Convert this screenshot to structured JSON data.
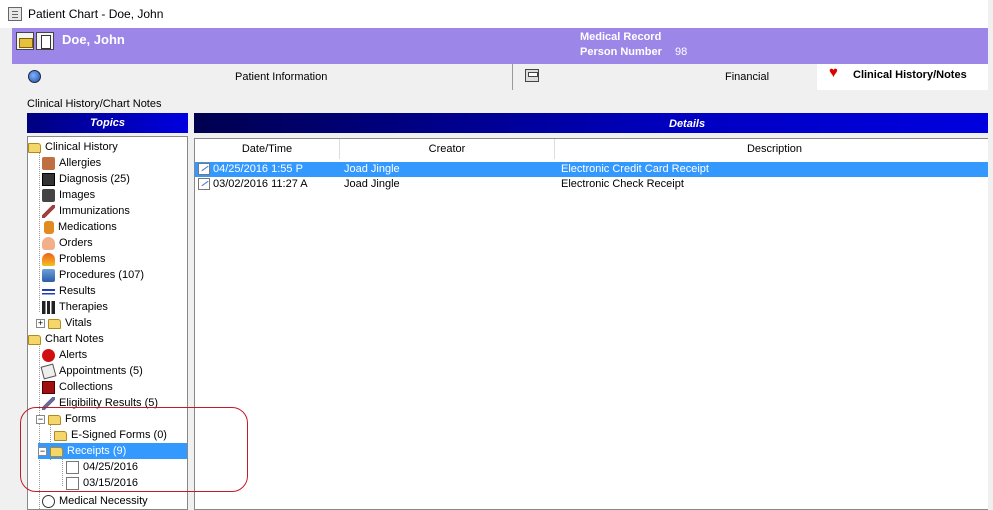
{
  "window": {
    "title": "Patient Chart - Doe, John"
  },
  "header": {
    "patient_name": "Doe, John",
    "medical_record_label": "Medical Record",
    "person_number_label": "Person Number",
    "person_number_value": "98",
    "accent_color": "#9c86e8"
  },
  "tabs": [
    {
      "label": "Patient Information",
      "icon": "globe-icon"
    },
    {
      "label": "Financial",
      "icon": "calculator-icon"
    },
    {
      "label": "Clinical History/Notes",
      "icon": "heart-icon",
      "active": true
    }
  ],
  "section_label": "Clinical History/Chart Notes",
  "topics": {
    "header": "Topics",
    "tree": [
      {
        "label": "Clinical History",
        "icon": "folder-icon",
        "level": 0
      },
      {
        "label": "Allergies",
        "icon": "allergies-icon",
        "level": 1
      },
      {
        "label": "Diagnosis (25)",
        "icon": "diagnosis-icon",
        "level": 1
      },
      {
        "label": "Images",
        "icon": "camera-icon",
        "level": 1
      },
      {
        "label": "Immunizations",
        "icon": "syringe-icon",
        "level": 1
      },
      {
        "label": "Medications",
        "icon": "pill-bottle-icon",
        "level": 1
      },
      {
        "label": "Orders",
        "icon": "orders-icon",
        "level": 1
      },
      {
        "label": "Problems",
        "icon": "problems-icon",
        "level": 1
      },
      {
        "label": "Procedures (107)",
        "icon": "procedures-icon",
        "level": 1
      },
      {
        "label": "Results",
        "icon": "results-icon",
        "level": 1
      },
      {
        "label": "Therapies",
        "icon": "dumbbell-icon",
        "level": 1
      },
      {
        "label": "Vitals",
        "icon": "folder-icon",
        "level": 1,
        "expander": "+"
      },
      {
        "label": "Chart Notes",
        "icon": "folder-icon",
        "level": 0
      },
      {
        "label": "Alerts",
        "icon": "alert-icon",
        "level": 1
      },
      {
        "label": "Appointments (5)",
        "icon": "appointment-icon",
        "level": 1
      },
      {
        "label": "Collections",
        "icon": "collections-icon",
        "level": 1
      },
      {
        "label": "Eligibility Results (5)",
        "icon": "eligibility-icon",
        "level": 1
      },
      {
        "label": "Forms",
        "icon": "folder-icon",
        "level": 1,
        "expander": "−"
      },
      {
        "label": "E-Signed Forms (0)",
        "icon": "folder-icon",
        "level": 2
      },
      {
        "label": "Receipts (9)",
        "icon": "folder-open-icon",
        "level": 2,
        "expander": "−",
        "selected": true
      },
      {
        "label": "04/25/2016",
        "icon": "document-icon",
        "level": 3
      },
      {
        "label": "03/15/2016",
        "icon": "document-icon",
        "level": 3
      },
      {
        "label": "Medical Necessity",
        "icon": "clock-icon",
        "level": 1
      }
    ]
  },
  "details": {
    "header": "Details",
    "columns": [
      "Date/Time",
      "Creator",
      "Description"
    ],
    "rows": [
      {
        "date": "04/25/2016 1:55 P",
        "creator": "Joad Jingle",
        "description": "Electronic Credit Card Receipt",
        "selected": true
      },
      {
        "date": "03/02/2016 11:27 A",
        "creator": "Joad Jingle",
        "description": "Electronic Check Receipt",
        "selected": false
      }
    ]
  }
}
